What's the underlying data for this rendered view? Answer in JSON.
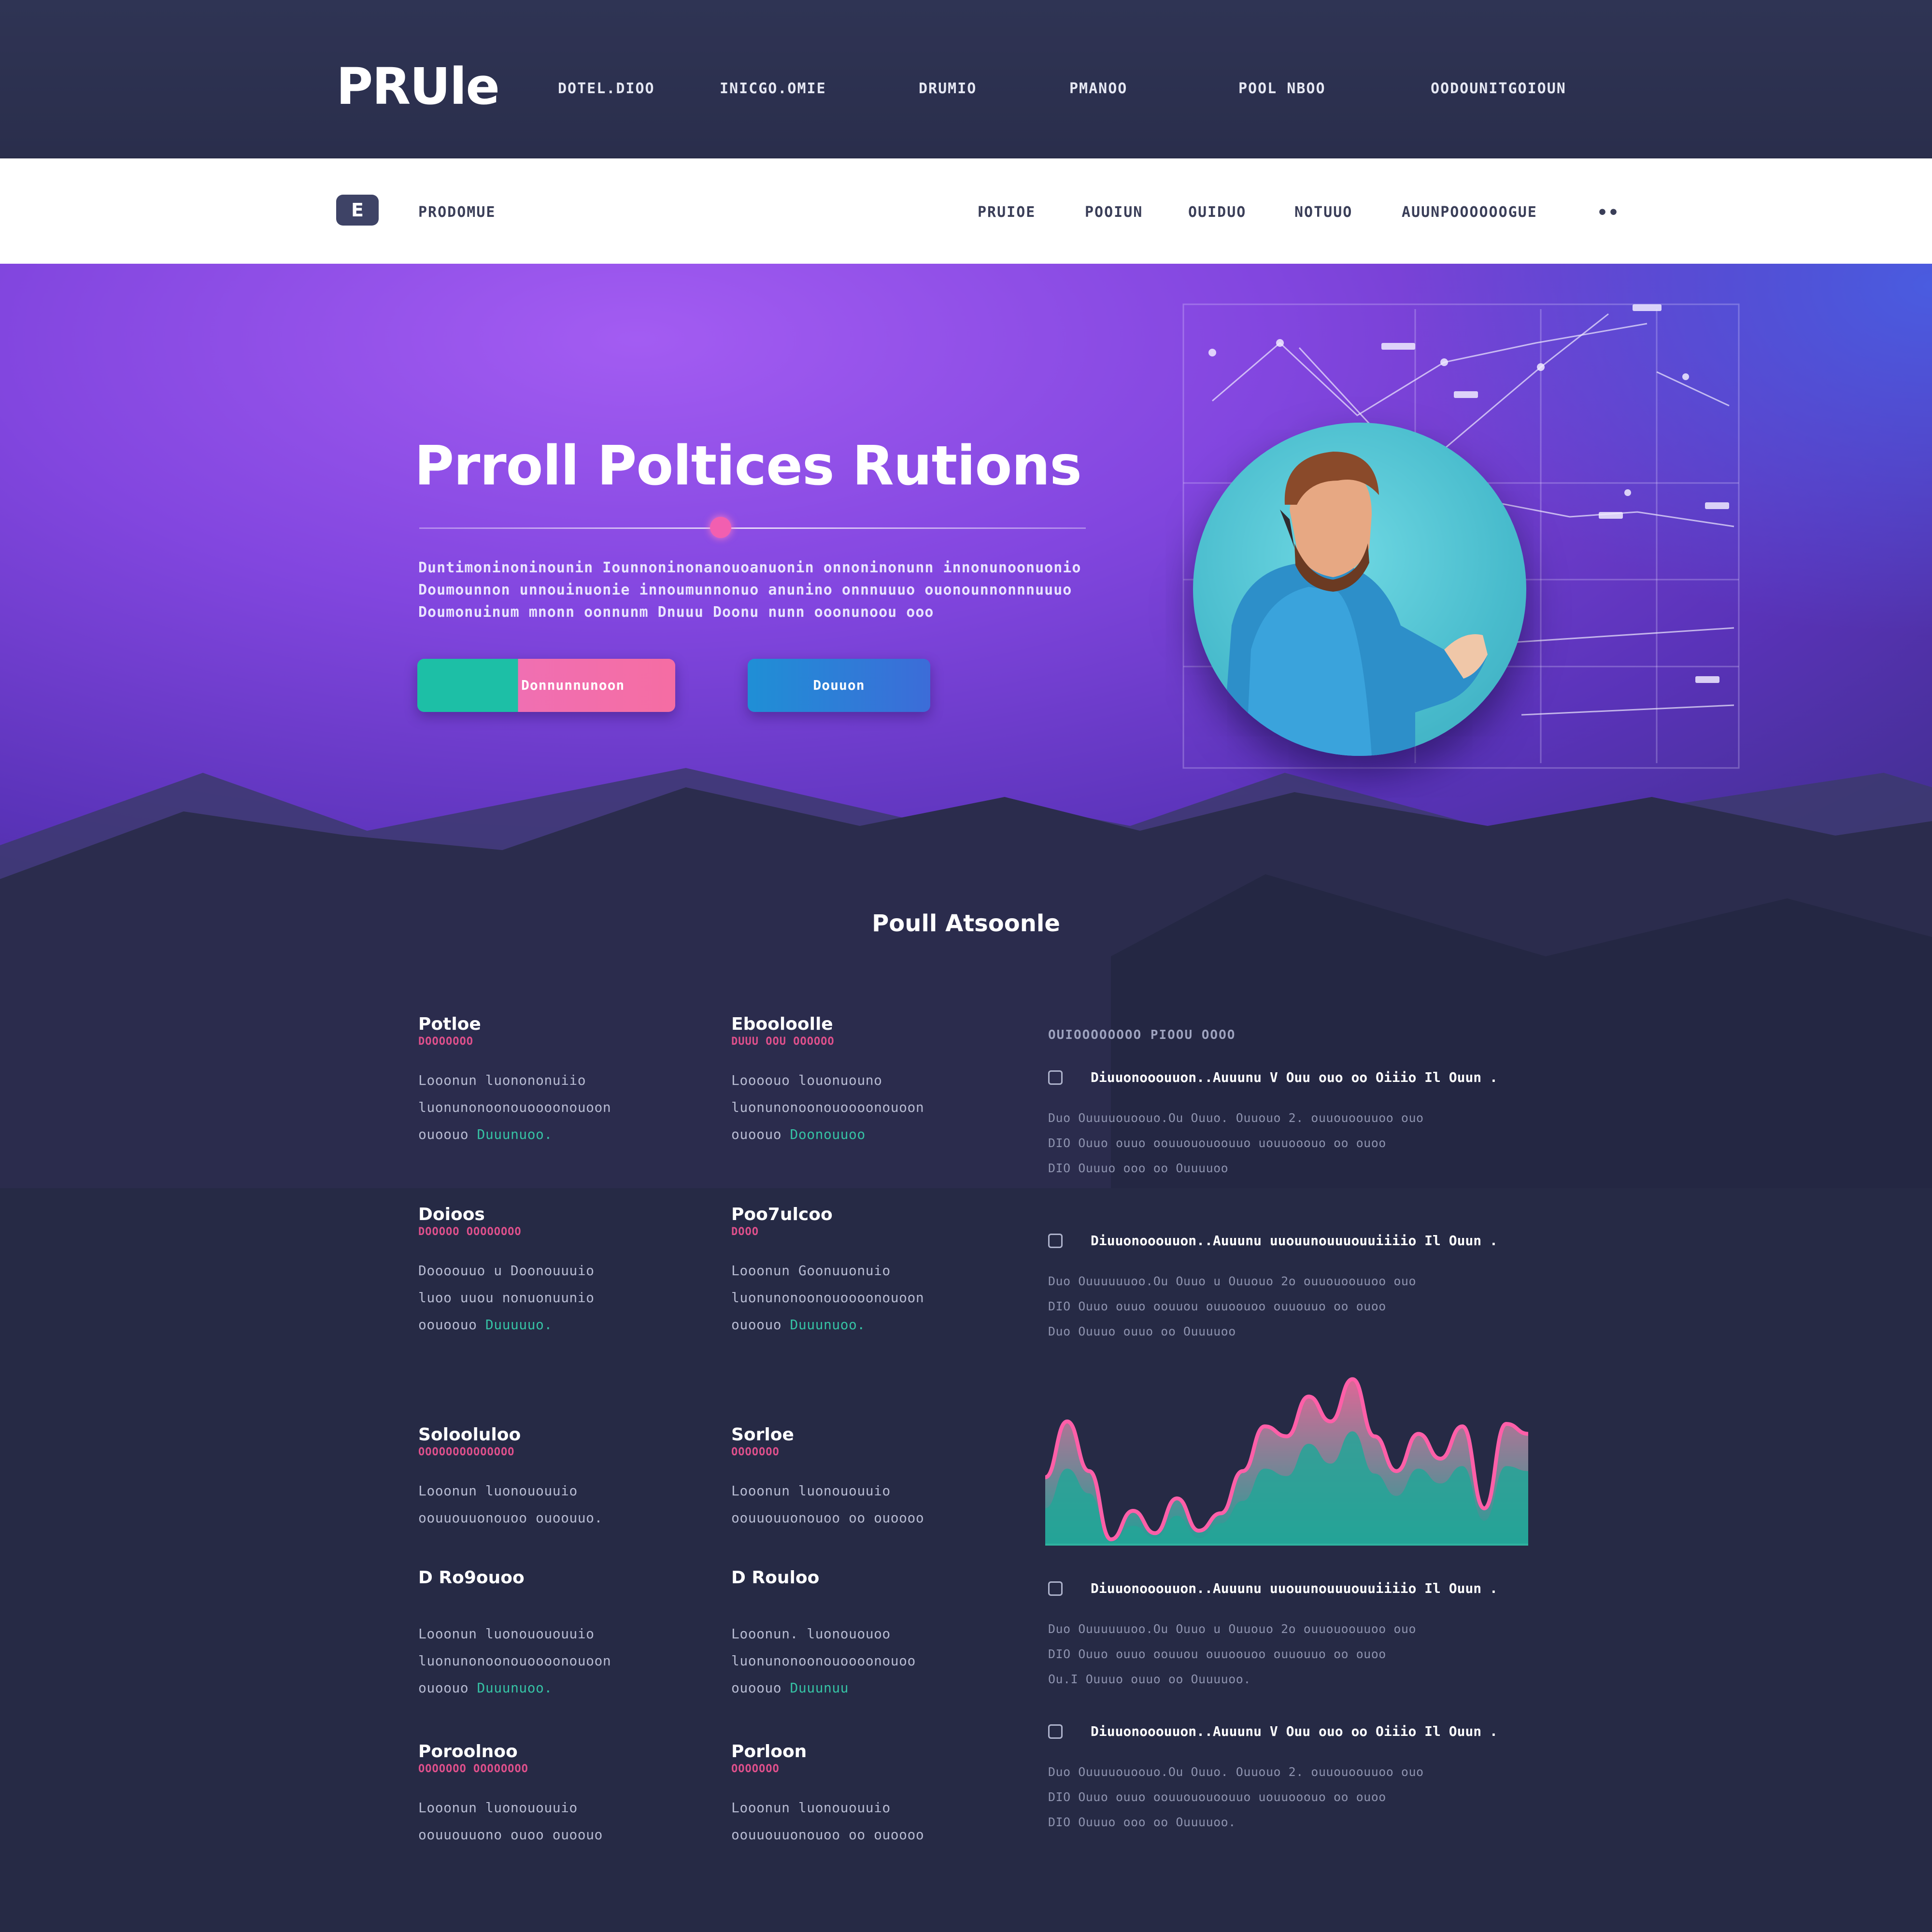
{
  "brand": {
    "logo": "PRUle",
    "sub_logo_icon": "E",
    "sub_brand": "PRODOMUE"
  },
  "top_nav": [
    "DOTEL.DIOO",
    "INICGO.OMIE",
    "DRUMIO",
    "PMANOO",
    "POOL NBOO",
    "OODOUNITGOIOUN"
  ],
  "sub_nav": [
    "PRUIOE",
    "POOIUN",
    "OUIDUO",
    "NOTUUO",
    "AUUNPOOOOOOGUE"
  ],
  "sub_nav_more": "••",
  "hero": {
    "title": "Prroll Poltices Rutions",
    "lead": [
      "Duntimoninoninounin Iounnoninonanouoanuonin onnoninonunn innonunoonuonio",
      "Doumounnon unnouinuonie innoumunnonuo anunino onnnuuuo ouonounnonnnuuuo",
      "Doumonuinum mnonn oonnunm Dnuuu     Doonu nunn ooonunoou ooo"
    ],
    "primary_button": "Donnunnunoon",
    "secondary_button": "Douuon"
  },
  "section_title": "Poull Atsoonle",
  "features": [
    {
      "title": "Potloe",
      "sub": "DOOOOOOO",
      "lines": [
        "Looonun luonononuiio",
        "luonunonoonouoooonouoon"
      ],
      "accent_pre": "ouoouo ",
      "accent": "Duuunuoo."
    },
    {
      "title": "Ebooloolle",
      "sub": "DUUU OOU OOOOOO",
      "lines": [
        "Loooouo louonuouno",
        "luonunonoonouoooonouoon"
      ],
      "accent_pre": "ouoouo ",
      "accent": "Doonouuoo"
    },
    {
      "title": "Doioos",
      "sub": "DOOOOO OOOOOOOO",
      "lines": [
        "Doooouuo u Doonouuuio",
        "luoo uuou nonuonuunio"
      ],
      "accent_pre": "oouoouo ",
      "accent": "Duuuuuo."
    },
    {
      "title": "Poo7ulcoo",
      "sub": "DOOO",
      "lines": [
        "Looonun Goonuuonuio",
        "luonunonoonouoooonouoon"
      ],
      "accent_pre": "ouoouo ",
      "accent": "Duuunuoo."
    },
    {
      "title": "Solooluloo",
      "sub": "OOOOOOOOOOOOOO",
      "lines": [
        "Looonun luonououuio",
        "oouuouuonouoo ouoouuo."
      ],
      "accent_pre": "",
      "accent": ""
    },
    {
      "title": "Sorloe",
      "sub": "OOOOOOO",
      "lines": [
        "Looonun luonououuio",
        "oouuouuonouoo oo ouoooo"
      ],
      "accent_pre": "",
      "accent": ""
    },
    {
      "title": "D Ro9ouoo",
      "sub": "",
      "lines": [
        "Looonun luonouououuio",
        "luonunonoonouoooonouoon"
      ],
      "accent_pre": "ouoouo ",
      "accent": "Duuunuoo."
    },
    {
      "title": "D Rouloo",
      "sub": "",
      "lines": [
        "Looonun. luonououoo",
        "luonunonoonouoooonouoo"
      ],
      "accent_pre": "ouoouo ",
      "accent": "Duuunuu"
    },
    {
      "title": "Poroolnoo",
      "sub": "OOOOOOO OOOOOOOO",
      "lines": [
        "Looonun luonououuio",
        "oouuouuono ouoo ouoouo"
      ],
      "accent_pre": "",
      "accent": ""
    },
    {
      "title": "Porloon",
      "sub": "OOOOOOO",
      "lines": [
        "Looonun luonououuio",
        "oouuouuonouoo oo ouoooo"
      ],
      "accent_pre": "",
      "accent": ""
    }
  ],
  "right_column": {
    "header": "OUIOOOOOOOO PIOOU OOOO",
    "items": [
      {
        "title": "Diuuonooouuon..Auuunu V Ouu ouo oo Oiiio Il Ouun .",
        "lines": [
          "Duo Ouuuuouoouo.Ou Ouuo. Ouuouo 2.  ouuouoouuoo ouo",
          "DIO Ouuo ouuo oouuououoouuo uouuooouo oo ouoo",
          "DIO Ouuuo ooo oo Ouuuuoo"
        ]
      },
      {
        "title": "Diuuonooouuon..Auuunu uuouunouuuouuiiiio Il Ouun .",
        "lines": [
          "Duo Ouuuuuuoo.Ou Ouuo u Ouuouo 2o ouuouoouuoo ouo",
          "DIO Ouuo ouuo oouuou ouuoouoo ouuouuo oo ouoo",
          "Duo Ouuuo ouuo oo Ouuuuoo"
        ]
      },
      {
        "title": "Diuuonooouuon..Auuunu uuouunouuuouuiiiio Il Ouun .",
        "lines": [
          "Duo Ouuuuuuoo.Ou Ouuo u Ouuouo 2o ouuouoouuoo ouo",
          "DIO Ouuo ouuo oouuou ouuoouoo ouuouuo oo ouoo",
          "Ou.I Ouuuo ouuo oo Ouuuuoo."
        ]
      },
      {
        "title": "Diuuonooouuon..Auuunu V Ouu ouo oo Oiiio Il Ouun .",
        "lines": [
          "Duo Ouuuuouoouo.Ou Ouuo. Ouuouo 2.  ouuouoouuoo ouo",
          "DIO Ouuo ouuo oouuououoouuo uouuooouo oo ouoo",
          "DIO Ouuuo ooo oo Ouuuuoo."
        ]
      }
    ]
  },
  "chart_data": {
    "type": "area",
    "title": "",
    "xlabel": "",
    "ylabel": "",
    "series": [
      {
        "values": [
          55,
          100,
          60,
          5,
          28,
          10,
          38,
          12,
          26,
          60,
          96,
          88,
          120,
          100,
          134,
          88,
          60,
          90,
          70,
          96,
          30,
          98,
          90
        ]
      },
      {
        "values": [
          30,
          62,
          42,
          3,
          16,
          6,
          24,
          6,
          18,
          36,
          62,
          56,
          82,
          66,
          92,
          58,
          40,
          62,
          50,
          64,
          20,
          64,
          60
        ]
      }
    ],
    "colors": {
      "line": "#ff5fa8",
      "fill_top": "#e76a9b",
      "fill_bottom": "#1fa59a",
      "inner_fill": "#25a598"
    }
  },
  "colors": {
    "accent_pink": "#f06fb2",
    "accent_teal": "#1dbfa6",
    "hero_purple": "#8246df",
    "background": "#262a45"
  }
}
